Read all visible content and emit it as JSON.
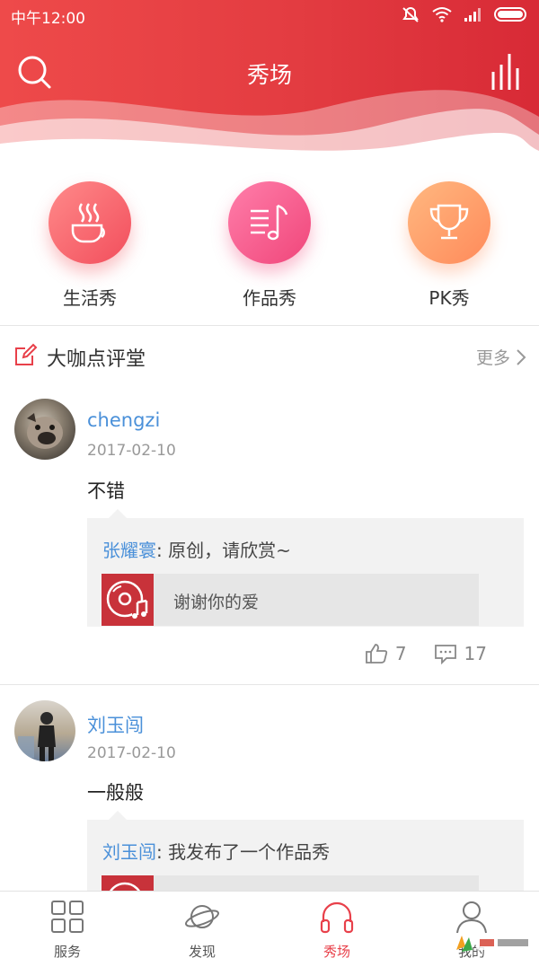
{
  "status_bar": {
    "time": "中午12:00"
  },
  "header": {
    "title": "秀场"
  },
  "categories": [
    {
      "label": "生活秀",
      "icon": "coffee-cup-icon"
    },
    {
      "label": "作品秀",
      "icon": "music-list-icon"
    },
    {
      "label": "PK秀",
      "icon": "trophy-icon"
    }
  ],
  "section": {
    "title": "大咖点评堂",
    "more": "更多"
  },
  "comments": [
    {
      "user": "chengzi",
      "date": "2017-02-10",
      "text": "不错",
      "quote_user": "张耀寰",
      "quote_text": ": 原创，请欣赏~",
      "work_title": "谢谢你的爱",
      "likes": "7",
      "replies": "17"
    },
    {
      "user": "刘玉闯",
      "date": "2017-02-10",
      "text": "一般般",
      "quote_user": "刘玉闯",
      "quote_text": ": 我发布了一个作品秀"
    }
  ],
  "nav": [
    {
      "label": "服务",
      "icon": "grid-icon"
    },
    {
      "label": "发现",
      "icon": "planet-icon"
    },
    {
      "label": "秀场",
      "icon": "headphones-icon",
      "active": true
    },
    {
      "label": "我的",
      "icon": "user-icon"
    }
  ],
  "colors": {
    "brand_red": "#e33c41",
    "link_blue": "#4a90d9",
    "active_tab": "#e8404a"
  }
}
